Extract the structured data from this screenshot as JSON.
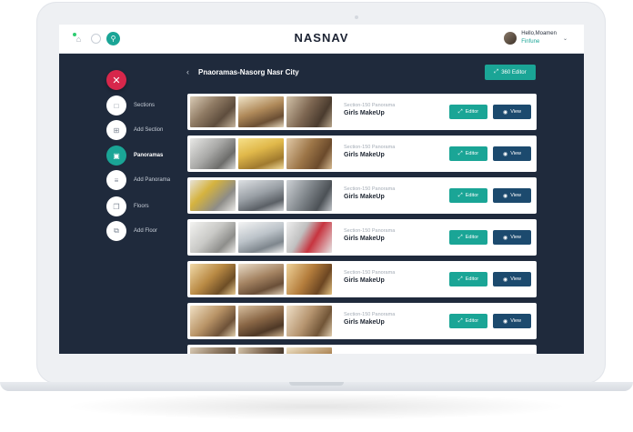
{
  "app": {
    "brand": "NASNAV",
    "user": {
      "greeting": "Hello,Moamen",
      "role": "Finfune",
      "chevron": "⌄"
    },
    "topbar_icons": [
      "notification-bell-icon",
      "loading-spinner-icon",
      "search-icon"
    ]
  },
  "sidebar": {
    "close_icon": "✕",
    "items": [
      {
        "label": "Sections",
        "icon": "square-icon",
        "active": false
      },
      {
        "label": "Add Section",
        "icon": "square-plus-icon",
        "active": false
      },
      {
        "label": "Panoramas",
        "icon": "image-icon",
        "active": true
      },
      {
        "label": "Add Panorama",
        "icon": "sliders-icon",
        "active": false
      },
      {
        "label": "Floors",
        "icon": "copy-icon",
        "active": false
      },
      {
        "label": "Add Floor",
        "icon": "copy-plus-icon",
        "active": false
      }
    ]
  },
  "header": {
    "back": "‹",
    "title": "Pnaoramas-Nasorg Nasr City",
    "editor360_label": "360 Editor"
  },
  "rows": [
    {
      "section": "Section-150 Panorama",
      "name": "Girls MakeUp",
      "editor": "Editor",
      "view": "View"
    },
    {
      "section": "Section-150 Panorama",
      "name": "Girls MakeUp",
      "editor": "Editor",
      "view": "View"
    },
    {
      "section": "Section-150 Panorama",
      "name": "Girls MakeUp",
      "editor": "Editor",
      "view": "View"
    },
    {
      "section": "Section-150 Panorama",
      "name": "Girls MakeUp",
      "editor": "Editor",
      "view": "View"
    },
    {
      "section": "Section-150 Panorama",
      "name": "Girls MakeUp",
      "editor": "Editor",
      "view": "View"
    },
    {
      "section": "Section-150 Panorama",
      "name": "Girls MakeUp",
      "editor": "Editor",
      "view": "View"
    }
  ],
  "colors": {
    "accent": "#1aa596",
    "danger": "#d7274b",
    "dark_button": "#1c4a6e",
    "screen_bg": "#1f2a3c"
  }
}
